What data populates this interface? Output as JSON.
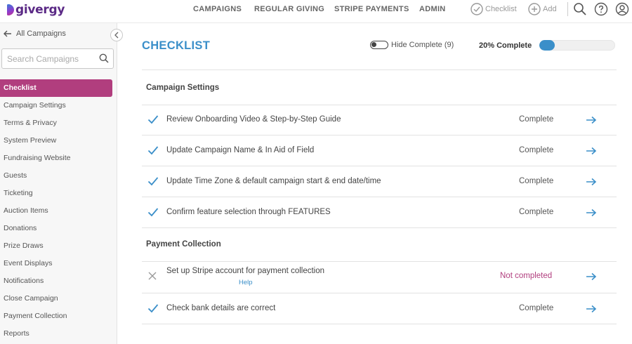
{
  "app": {
    "logo_text": "givergy"
  },
  "nav": {
    "campaigns": "CAMPAIGNS",
    "regular_giving": "REGULAR GIVING",
    "stripe_payments": "STRIPE PAYMENTS",
    "admin": "ADMIN"
  },
  "toolbar": {
    "checklist": "Checklist",
    "add": "Add"
  },
  "sidebar": {
    "back_label": "All Campaigns",
    "search_placeholder": "Search Campaigns",
    "items": [
      "Checklist",
      "Campaign Settings",
      "Terms & Privacy",
      "System Preview",
      "Fundraising Website",
      "Guests",
      "Ticketing",
      "Auction Items",
      "Donations",
      "Prize Draws",
      "Event Displays",
      "Notifications",
      "Close Campaign",
      "Payment Collection",
      "Reports"
    ],
    "active_index": 0
  },
  "main": {
    "title": "CHECKLIST",
    "hide_complete": "Hide Complete (9)",
    "percent_label": "20% Complete",
    "progress": 0.2,
    "sections": [
      {
        "title": "Campaign Settings",
        "rows": [
          {
            "label": "Review Onboarding Video & Step-by-Step Guide",
            "status": "Complete",
            "done": true
          },
          {
            "label": "Update Campaign Name & In Aid of Field",
            "status": "Complete",
            "done": true
          },
          {
            "label": "Update Time Zone & default campaign start & end date/time",
            "status": "Complete",
            "done": true
          },
          {
            "label": "Confirm feature selection through FEATURES",
            "status": "Complete",
            "done": true
          }
        ]
      },
      {
        "title": "Payment Collection",
        "rows": [
          {
            "label": "Set up Stripe account for payment collection",
            "help": "Help",
            "status": "Not completed",
            "done": false
          },
          {
            "label": "Check bank details are correct",
            "status": "Complete",
            "done": true
          }
        ]
      }
    ]
  },
  "colors": {
    "accent": "#3b8fc9",
    "active_menu": "#b13e7e",
    "not_completed": "#b13e7e"
  }
}
